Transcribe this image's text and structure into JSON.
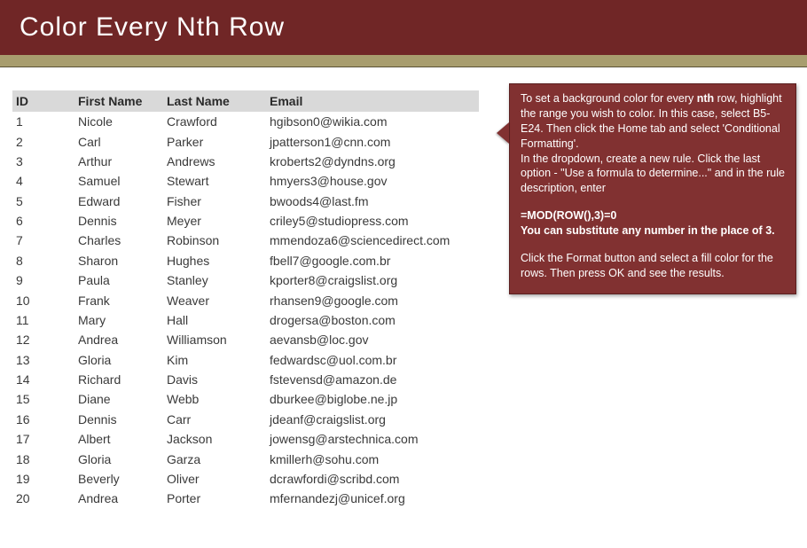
{
  "title": "Color Every Nth Row",
  "table": {
    "headers": {
      "id": "ID",
      "first": "First Name",
      "last": "Last Name",
      "email": "Email"
    },
    "rows": [
      {
        "id": "1",
        "first": "Nicole",
        "last": "Crawford",
        "email": "hgibson0@wikia.com"
      },
      {
        "id": "2",
        "first": "Carl",
        "last": "Parker",
        "email": "jpatterson1@cnn.com"
      },
      {
        "id": "3",
        "first": "Arthur",
        "last": "Andrews",
        "email": "kroberts2@dyndns.org"
      },
      {
        "id": "4",
        "first": "Samuel",
        "last": "Stewart",
        "email": "hmyers3@house.gov"
      },
      {
        "id": "5",
        "first": "Edward",
        "last": "Fisher",
        "email": "bwoods4@last.fm"
      },
      {
        "id": "6",
        "first": "Dennis",
        "last": "Meyer",
        "email": "criley5@studiopress.com"
      },
      {
        "id": "7",
        "first": "Charles",
        "last": "Robinson",
        "email": "mmendoza6@sciencedirect.com"
      },
      {
        "id": "8",
        "first": "Sharon",
        "last": "Hughes",
        "email": "fbell7@google.com.br"
      },
      {
        "id": "9",
        "first": "Paula",
        "last": "Stanley",
        "email": "kporter8@craigslist.org"
      },
      {
        "id": "10",
        "first": "Frank",
        "last": "Weaver",
        "email": "rhansen9@google.com"
      },
      {
        "id": "11",
        "first": "Mary",
        "last": "Hall",
        "email": "drogersa@boston.com"
      },
      {
        "id": "12",
        "first": "Andrea",
        "last": "Williamson",
        "email": "aevansb@loc.gov"
      },
      {
        "id": "13",
        "first": "Gloria",
        "last": "Kim",
        "email": "fedwardsc@uol.com.br"
      },
      {
        "id": "14",
        "first": "Richard",
        "last": "Davis",
        "email": "fstevensd@amazon.de"
      },
      {
        "id": "15",
        "first": "Diane",
        "last": "Webb",
        "email": "dburkee@biglobe.ne.jp"
      },
      {
        "id": "16",
        "first": "Dennis",
        "last": "Carr",
        "email": "jdeanf@craigslist.org"
      },
      {
        "id": "17",
        "first": "Albert",
        "last": "Jackson",
        "email": "jowensg@arstechnica.com"
      },
      {
        "id": "18",
        "first": "Gloria",
        "last": "Garza",
        "email": "kmillerh@sohu.com"
      },
      {
        "id": "19",
        "first": "Beverly",
        "last": "Oliver",
        "email": "dcrawfordi@scribd.com"
      },
      {
        "id": "20",
        "first": "Andrea",
        "last": "Porter",
        "email": "mfernandezj@unicef.org"
      }
    ]
  },
  "callout": {
    "p1a": "To set a background color for every ",
    "p1b": "nth",
    "p1c": " row, highlight the range you wish to color. In this case, select B5-E24. Then click the Home tab and select 'Conditional Formatting'.",
    "p2": "In the dropdown, create a new rule. Click the last option - \"Use a formula to determine...\" and in the rule description, enter",
    "formula": "=MOD(ROW(),3)=0",
    "sub": "You can substitute any number in the place of 3.",
    "p3": "Click the Format button and select a fill color for the rows. Then press OK and see the results."
  }
}
